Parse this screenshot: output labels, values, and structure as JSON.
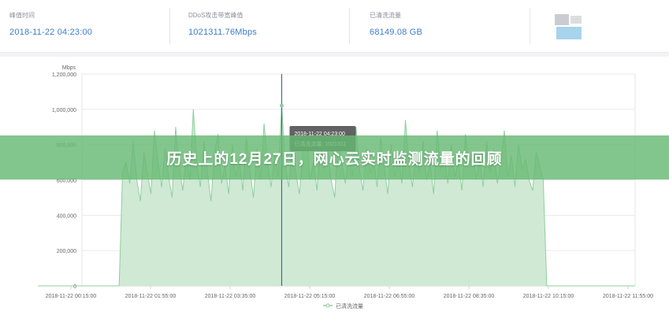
{
  "stats": [
    {
      "label": "峰值时间",
      "value": "2018-11-22 04:23:00"
    },
    {
      "label": "DDoS攻击带宽峰值",
      "value": "1021311.76Mbps"
    },
    {
      "label": "已清洗流量",
      "value": "68149.08 GB"
    }
  ],
  "banner": {
    "title": "历史上的12月27日，网心云实时监测流量的回顾"
  },
  "colors": {
    "series_fill": "#cfe9d4",
    "series_line": "#8fcf9c",
    "cursor": "#3f6d8f",
    "value_text": "#3d7cc9"
  },
  "chart_data": {
    "type": "area",
    "title": "",
    "ylabel": "Mbps",
    "xlabel": "",
    "ylim": [
      0,
      1200000
    ],
    "yticks": [
      0,
      200000,
      400000,
      600000,
      800000,
      1000000,
      1200000
    ],
    "ytick_labels": [
      "0",
      "200,000",
      "400,000",
      "600,000",
      "800,000",
      "1,000,000",
      "1,200,000"
    ],
    "xtick_labels": [
      "2018-11-22 00:15:00",
      "2018-11-22 01:55:00",
      "2018-11-22 03:35:00",
      "2018-11-22 05:15:00",
      "2018-11-22 06:55:00",
      "2018-11-22 08:35:00",
      "2018-11-22 10:15:00",
      "2018-11-22 11:55:00"
    ],
    "grid": true,
    "legend": {
      "position": "bottom-center",
      "entries": [
        "已清洗流量"
      ]
    },
    "tooltip": {
      "time": "2018-11-22 04:23:00",
      "label": "已清洗流量",
      "value": "1021311"
    },
    "cursor_time": "2018-11-22 04:23:00",
    "series": [
      {
        "name": "已清洗流量",
        "values": [
          0,
          0,
          0,
          0,
          0,
          0,
          0,
          0,
          0,
          0,
          0,
          0,
          0,
          0,
          0,
          0,
          0,
          0,
          0,
          0,
          0,
          0,
          0,
          0,
          650000,
          700000,
          580000,
          820000,
          600000,
          480000,
          760000,
          640000,
          520000,
          880000,
          700000,
          560000,
          780000,
          620000,
          500000,
          900000,
          680000,
          540000,
          740000,
          600000,
          1000000,
          700000,
          560000,
          820000,
          640000,
          480000,
          760000,
          860000,
          580000,
          680000,
          520000,
          800000,
          620000,
          720000,
          540000,
          840000,
          660000,
          500000,
          780000,
          600000,
          920000,
          700000,
          560000,
          740000,
          620000,
          1021311,
          680000,
          560000,
          800000,
          640000,
          520000,
          760000,
          880000,
          600000,
          700000,
          540000,
          820000,
          660000,
          780000,
          600000,
          500000,
          860000,
          700000,
          580000,
          740000,
          620000,
          900000,
          660000,
          540000,
          780000,
          640000,
          720000,
          560000,
          840000,
          680000,
          520000,
          800000,
          620000,
          740000,
          580000,
          940000,
          700000,
          560000,
          760000,
          640000,
          820000,
          600000,
          700000,
          520000,
          880000,
          660000,
          740000,
          580000,
          800000,
          620000,
          700000,
          540000,
          860000,
          680000,
          760000,
          600000,
          720000,
          560000,
          820000,
          640000,
          780000,
          580000,
          700000,
          880000,
          620000,
          740000,
          560000,
          800000,
          660000,
          720000,
          600000,
          540000,
          760000,
          680000,
          600000,
          0,
          0,
          0,
          0,
          0,
          0,
          0,
          0,
          0,
          0,
          0,
          0,
          0,
          0,
          0,
          0,
          0,
          0,
          0,
          0,
          0,
          0,
          0,
          0,
          0,
          0
        ]
      }
    ]
  }
}
